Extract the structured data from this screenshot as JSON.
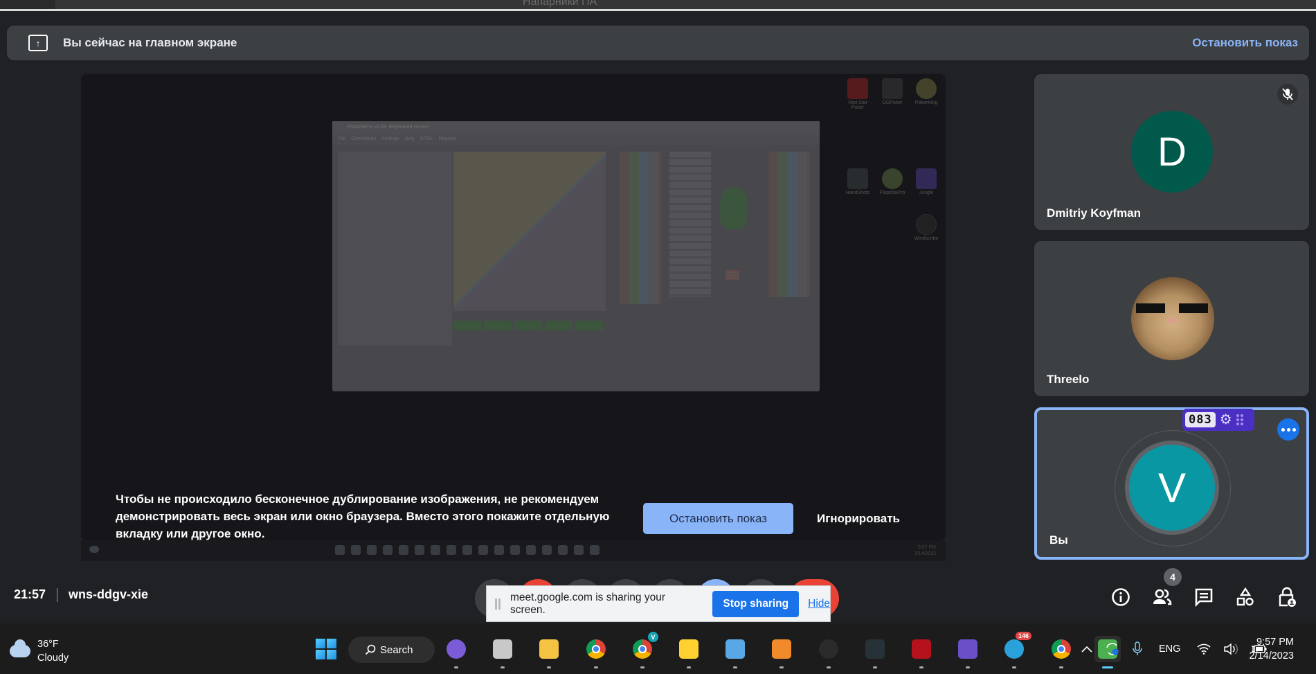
{
  "remote_window": {
    "title": "Напарники ПА"
  },
  "banner": {
    "text": "Вы сейчас на главном экране",
    "stop_label": "Остановить показ"
  },
  "shared_screen": {
    "window_title": "FlopzillaPro v2.08. Registered version",
    "menu": [
      "File",
      "Commands",
      "Settings",
      "Help",
      "GTO+",
      "Register"
    ],
    "desktop_icons": [
      "Red Star Poker",
      "GGPoker",
      "PokerKing",
      "HandShots",
      "FlopzillaPro",
      "Jungle",
      "Windscribe"
    ]
  },
  "warning": {
    "message": "Чтобы не происходило бесконечное дублирование изображения, не рекомендуем демонстрировать весь экран или окно браузера. Вместо этого покажите отдельную вкладку или другое окно.",
    "stop_label": "Остановить показ",
    "ignore_label": "Игнорировать"
  },
  "participants": [
    {
      "name": "Dmitriy Koyfman",
      "initial": "D",
      "color": "#00594a",
      "muted": true
    },
    {
      "name": "Threelo",
      "initial": "",
      "avatar": "cat-with-sunglasses"
    },
    {
      "name": "Вы",
      "initial": "V",
      "color": "#0a97a4",
      "active": true,
      "counter": "083"
    }
  ],
  "meeting": {
    "time": "21:57",
    "code": "wns-ddgv-xie",
    "people_count": "4",
    "controls": [
      "mic",
      "camera-off",
      "captions",
      "raise-hand",
      "emoji",
      "present",
      "more-options",
      "end-call"
    ],
    "right_tools": [
      "meeting-details",
      "people",
      "chat",
      "activities",
      "host-controls"
    ]
  },
  "share_bar": {
    "text": "meet.google.com is sharing your screen.",
    "stop_label": "Stop sharing",
    "hide_label": "Hide"
  },
  "taskbar": {
    "weather_temp": "36°F",
    "weather_cond": "Cloudy",
    "search_label": "Search",
    "apps": [
      {
        "name": "meet",
        "color": "#7b5cd6"
      },
      {
        "name": "clock",
        "color": "#c8c8c8"
      },
      {
        "name": "file-explorer",
        "color": "#f5c342"
      },
      {
        "name": "chrome-profile-1",
        "color": "#db4437"
      },
      {
        "name": "chrome-profile-v",
        "color": "#0f9d58",
        "badge": "V"
      },
      {
        "name": "miro",
        "color": "#ffd02f"
      },
      {
        "name": "notepad",
        "color": "#5aa7e6"
      },
      {
        "name": "pdf",
        "color": "#f08a2a"
      },
      {
        "name": "windscribe",
        "color": "#2b2b2b"
      },
      {
        "name": "handshots",
        "color": "#263238"
      },
      {
        "name": "red-star-poker",
        "color": "#b5121b"
      },
      {
        "name": "jungle",
        "color": "#6b4fc8"
      },
      {
        "name": "telegram",
        "color": "#2aa1da",
        "badge": "146"
      },
      {
        "name": "chrome",
        "color": "#db4437"
      },
      {
        "name": "flopzilla",
        "color": "#4caf50",
        "active": true
      }
    ],
    "language": "ENG",
    "time": "9:57 PM",
    "date": "2/14/2023"
  }
}
